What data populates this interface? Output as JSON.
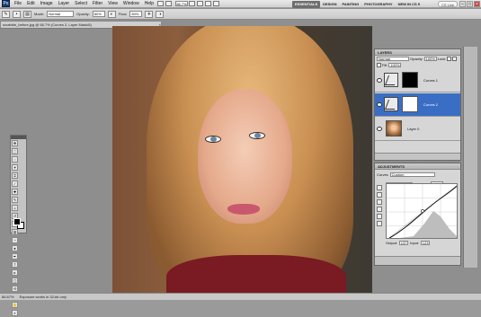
{
  "app": {
    "logo": "Ps",
    "zoom": "66.7%"
  },
  "menu": [
    "File",
    "Edit",
    "Image",
    "Layer",
    "Select",
    "Filter",
    "View",
    "Window",
    "Help"
  ],
  "workspaces": [
    "ESSENTIALS",
    "DESIGN",
    "PAINTING",
    "PHOTOGRAPHY",
    "NEW IN CS 5"
  ],
  "active_workspace": "ESSENTIALS",
  "cs_live": "CS Live",
  "options": {
    "mode_label": "Mode:",
    "mode_value": "Normal",
    "opacity_label": "Opacity:",
    "opacity_value": "80%",
    "flow_label": "Flow:",
    "flow_value": "80%"
  },
  "document": {
    "tab_title": "scrabble_before.jpg @ 66.7% (Curves 2, Layer Mask/8)"
  },
  "layers_panel": {
    "tab": "LAYERS",
    "blend": "Normal",
    "opacity_label": "Opacity:",
    "opacity": "100%",
    "lock_label": "Lock:",
    "fill_label": "Fill:",
    "fill": "100%",
    "layers": [
      {
        "name": "Curves 1",
        "selected": false
      },
      {
        "name": "Curves 2",
        "selected": true
      },
      {
        "name": "Layer 0",
        "selected": false
      }
    ]
  },
  "adjustments_panel": {
    "tab": "ADJUSTMENTS",
    "title": "Curves",
    "preset": "Custom",
    "channel": "RGB",
    "auto": "Auto",
    "output_label": "Output:",
    "output": "137",
    "input_label": "Input:",
    "input": "123"
  },
  "status": {
    "zoom": "66.67%",
    "info": "Exposure works in 32-bit only"
  }
}
